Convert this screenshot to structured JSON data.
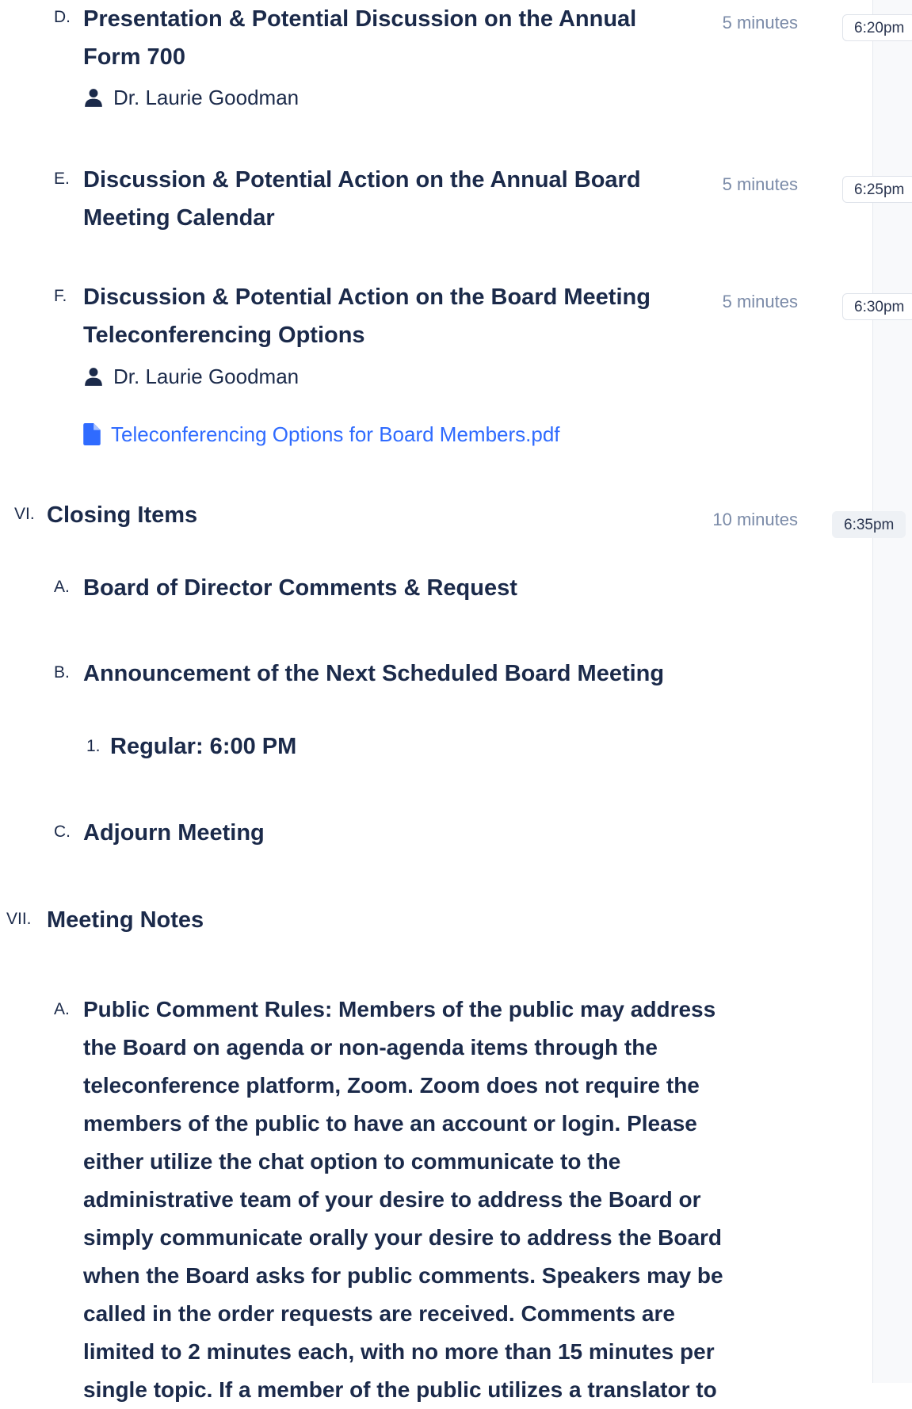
{
  "agenda": {
    "item_d": {
      "label": "D.",
      "title_line1": "Presentation & Potential Discussion on the Annual",
      "title_line2": "Form 700",
      "duration": "5 minutes",
      "time": "6:20pm",
      "presenter": "Dr. Laurie Goodman"
    },
    "item_e": {
      "label": "E.",
      "title_line1": "Discussion & Potential Action on the Annual Board",
      "title_line2": "Meeting Calendar",
      "duration": "5 minutes",
      "time": "6:25pm"
    },
    "item_f": {
      "label": "F.",
      "title_line1": "Discussion & Potential Action on the Board Meeting",
      "title_line2": "Teleconferencing Options",
      "duration": "5 minutes",
      "time": "6:30pm",
      "presenter": "Dr. Laurie Goodman",
      "attachment": "Teleconferencing Options for Board Members.pdf"
    },
    "section_vi": {
      "label": "VI.",
      "title": "Closing Items",
      "duration": "10 minutes",
      "time": "6:35pm"
    },
    "vi_a": {
      "label": "A.",
      "title": "Board of Director Comments & Request"
    },
    "vi_b": {
      "label": "B.",
      "title": "Announcement of the Next Scheduled Board Meeting"
    },
    "vi_b_1": {
      "label": "1.",
      "title": "Regular: 6:00 PM"
    },
    "vi_c": {
      "label": "C.",
      "title": "Adjourn Meeting"
    },
    "section_vii": {
      "label": "VII.",
      "title": "Meeting Notes"
    },
    "vii_a": {
      "label": "A.",
      "lines": [
        "Public Comment Rules: Members of the public may address",
        "the Board on agenda or non-agenda items through the",
        "teleconference platform, Zoom. Zoom does not require the",
        "members of the public to have an account or login. Please",
        "either utilize the chat option to communicate to the",
        "administrative team of your desire to address the Board or",
        "simply communicate orally your desire to address the Board",
        "when the Board asks for public comments. Speakers may be",
        "called in the order requests are received. Comments are",
        "limited to 2 minutes each, with no more than 15 minutes per",
        "single topic. If a member of the public utilizes a translator to"
      ]
    }
  },
  "colors": {
    "text": "#1b2a4a",
    "duration": "#7b8ba8",
    "link": "#2f6bff"
  }
}
